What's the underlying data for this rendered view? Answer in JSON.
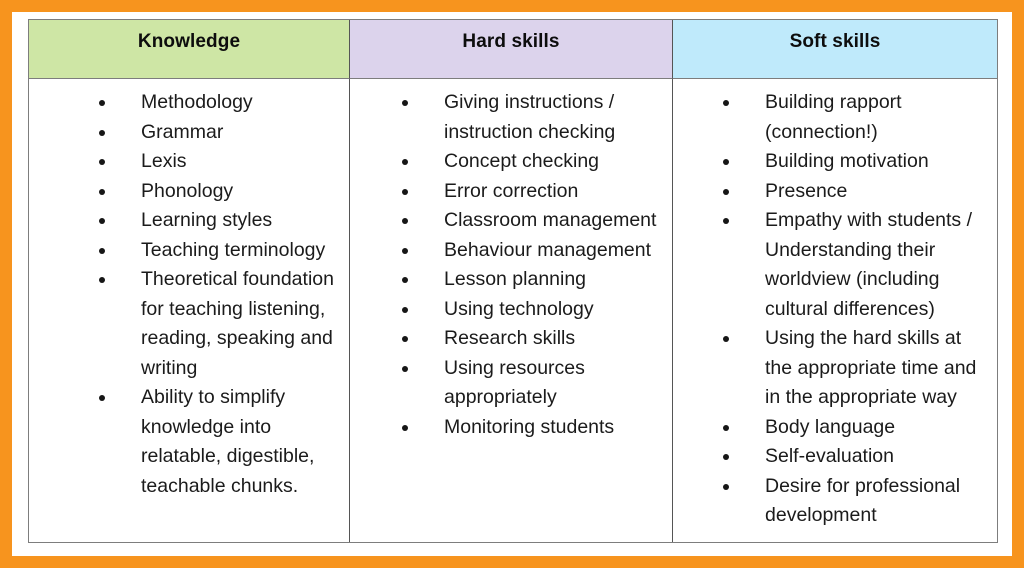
{
  "frame": {
    "outer_border_color": "#f7941e",
    "table_border_color": "#7d7d7d"
  },
  "table": {
    "columns": [
      {
        "key": "knowledge",
        "header": "Knowledge",
        "header_bg": "#cee6a5",
        "items": [
          "Methodology",
          "Grammar",
          "Lexis",
          "Phonology",
          "Learning styles",
          "Teaching terminology",
          "Theoretical foundation for teaching listening, reading, speaking and writing",
          "Ability to simplify knowledge into relatable, digestible, teachable chunks."
        ]
      },
      {
        "key": "hard_skills",
        "header": "Hard skills",
        "header_bg": "#dcd3ec",
        "items": [
          "Giving instructions / instruction checking",
          "Concept checking",
          "Error correction",
          "Classroom management",
          "Behaviour management",
          "Lesson planning",
          "Using technology",
          "Research skills",
          "Using resources appropriately",
          "Monitoring students"
        ]
      },
      {
        "key": "soft_skills",
        "header": "Soft skills",
        "header_bg": "#bfeafb",
        "items": [
          "Building rapport (connection!)",
          "Building motivation",
          "Presence",
          "Empathy with students / Understanding their worldview (including cultural differences)",
          "Using the hard skills at the appropriate time and in the appropriate way",
          "Body language",
          "Self-evaluation",
          "Desire for professional development"
        ]
      }
    ]
  }
}
